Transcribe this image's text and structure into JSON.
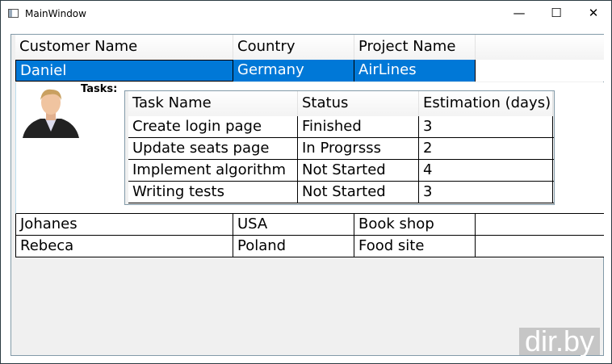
{
  "window": {
    "title": "MainWindow",
    "minimize": "—",
    "maximize": "☐",
    "close": "✕"
  },
  "grid": {
    "columns": [
      "Customer Name",
      "Country",
      "Project Name"
    ],
    "rows": [
      {
        "name": "Daniel",
        "country": "Germany",
        "project": "AirLines",
        "selected": true
      },
      {
        "name": "Johanes",
        "country": "USA",
        "project": "Book shop"
      },
      {
        "name": "Rebeca",
        "country": "Poland",
        "project": "Food site"
      }
    ]
  },
  "details": {
    "tasks_label": "Tasks:",
    "columns": [
      "Task Name",
      "Status",
      "Estimation (days)"
    ],
    "tasks": [
      {
        "name": "Create login page",
        "status": "Finished",
        "est": "3"
      },
      {
        "name": "Update seats page",
        "status": "In Progrsss",
        "est": "2"
      },
      {
        "name": "Implement algorithm",
        "status": "Not Started",
        "est": "4"
      },
      {
        "name": "Writing tests",
        "status": "Not Started",
        "est": "3"
      }
    ]
  },
  "watermark": "dir.by",
  "colors": {
    "selection": "#0078d7"
  }
}
